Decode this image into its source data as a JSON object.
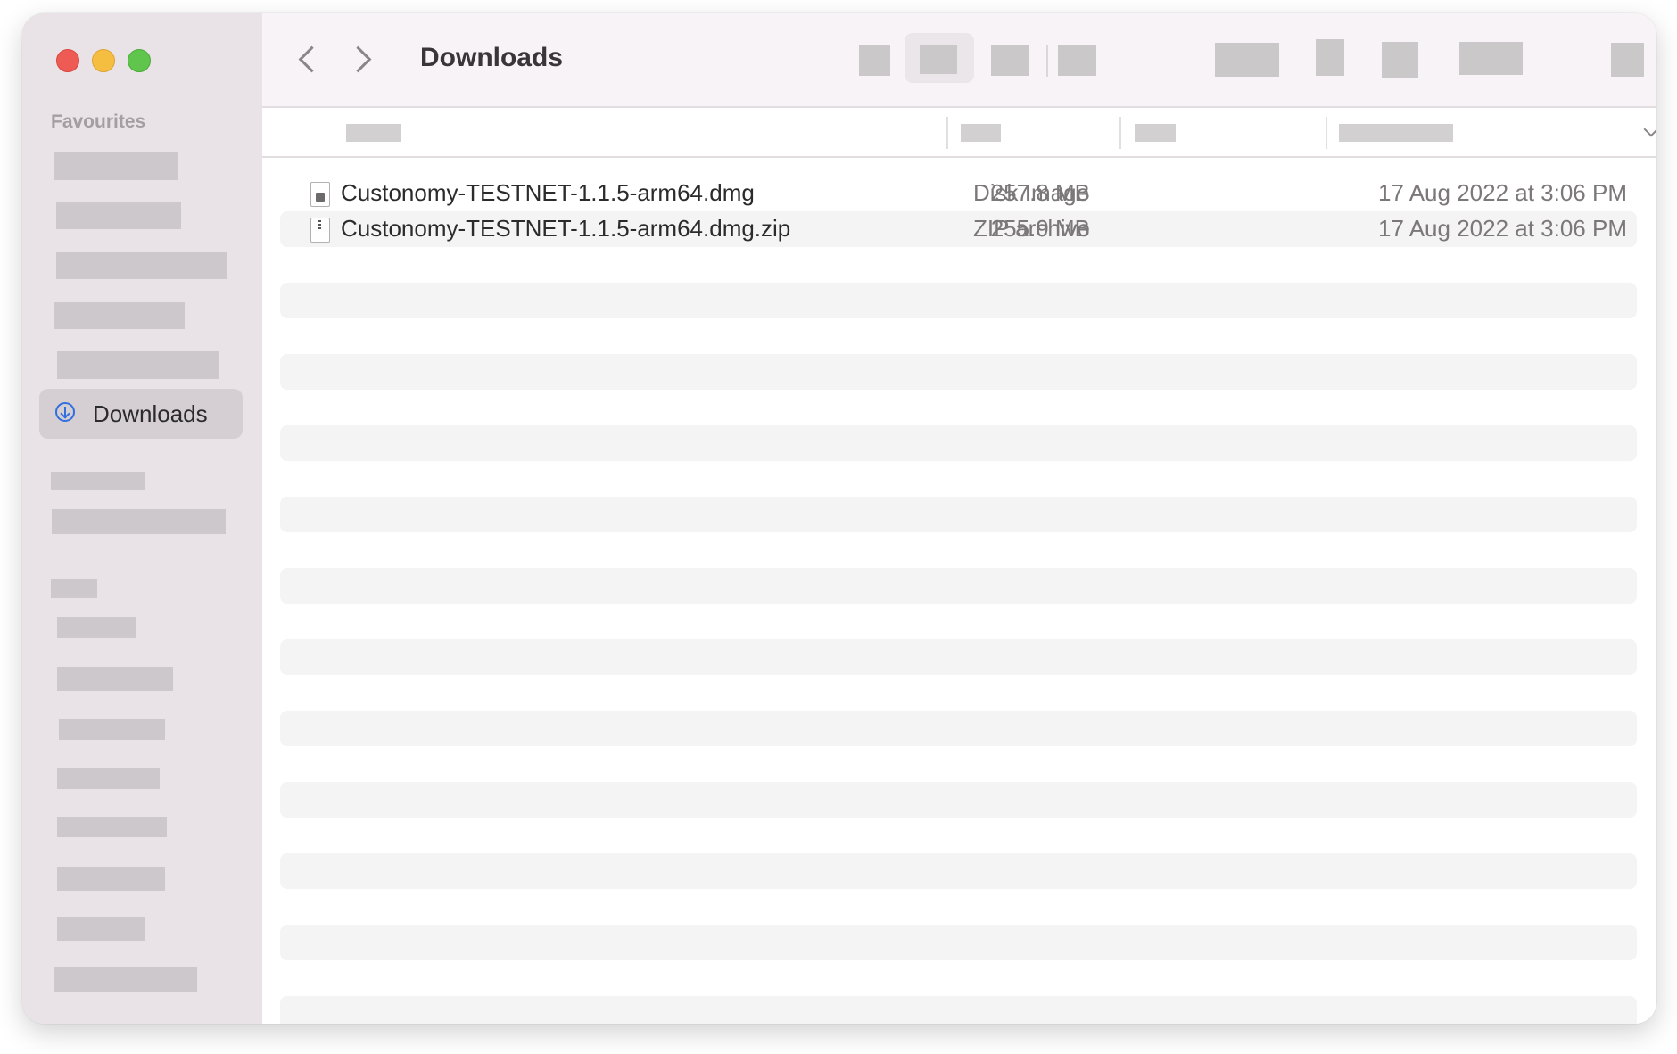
{
  "window": {
    "title": "Downloads"
  },
  "toolbar": {
    "back_icon": "chevron-left-icon",
    "forward_icon": "chevron-right-icon",
    "title": "Downloads"
  },
  "sidebar": {
    "section_favourites": "Favourites",
    "selected_item": {
      "label": "Downloads",
      "icon": "download-circle-icon",
      "icon_color": "#2f6fe0"
    }
  },
  "files": [
    {
      "name": "Custonomy-TESTNET-1.1.5-arm64.dmg",
      "size": "257.8 MB",
      "kind": "Disk Image",
      "date_added": "17 Aug 2022 at 3:06 PM",
      "icon": "disk-image-file-icon"
    },
    {
      "name": "Custonomy-TESTNET-1.1.5-arm64.dmg.zip",
      "size": "255.9 MB",
      "kind": "ZIP archive",
      "date_added": "17 Aug 2022 at 3:06 PM",
      "icon": "zip-file-icon"
    }
  ],
  "colors": {
    "traffic_close": "#ee5b55",
    "traffic_minimize": "#f6be40",
    "traffic_maximize": "#5fc54c",
    "sidebar_bg": "#e9e3e7",
    "selection": "#d5ced3"
  }
}
